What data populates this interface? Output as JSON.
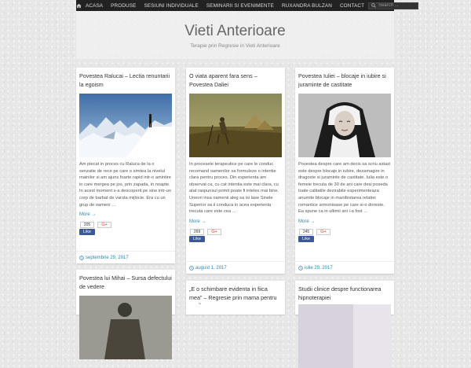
{
  "nav": {
    "items": [
      "ACASA",
      "PRODUSE",
      "SESIUNI INDIVIDUALE",
      "SEMINARII SI EVENIMENTE",
      "RUXANDRA BULZAN",
      "CONTACT"
    ],
    "search_placeholder": "Search ..."
  },
  "header": {
    "title": "Vieti Anterioare",
    "tagline": "Terapie prin Regresie in Vieti Anterioare"
  },
  "posts": [
    {
      "title": "Povestea Ralucai – Lectia renuntarii la egoism",
      "excerpt": "Am plecat in proces cu Raluca de la o senzatie de rece pe care o simtea la nivelul mainilor si am ajuns foarte rapid intr-o amintire in care mergea pe jos, prin zapada, in noapte. In acest moment s-a descoperit pe sine intr-un corp de barbat de varsta mijlocie. Era cu un grup de oameni …",
      "more": "More →",
      "fb_count": "205",
      "fb_like": "Like",
      "gplus": "G+",
      "date": "septembrie 29, 2017"
    },
    {
      "title": "O viata aparent fara sens – Povestea Daliei",
      "excerpt": "In procesele terapeutice pe care le conduc recomand oamenilor sa formuleze o intentie clara pentru proces. Din experienta am observat ca, cu cat intentia este mai clara, cu atat raspunsul primit poate fi inteles mai bine. Uneori insa oamenii aleg sa isi lase Sinele Superior sa ii conduca in acea experienta trecuta care este cea …",
      "more": "More →",
      "fb_count": "269",
      "fb_like": "Like",
      "gplus": "G+",
      "date": "august 1, 2017"
    },
    {
      "title": "Povestea Iuliei – blocaje in iubire si juraminte de castitate",
      "excerpt": "Povestea despre care am decis sa scriu astazi este despre blocaje in iubire, dezamagire in dragoste si juraminte de castitate. Iulia este o femeie trecuta de 30 de ani care desi poseda toate calitatile dezirabile experimenteaza anumite blocaje in manifestarea relatiei romantice armonioase pe care si-o doreste. Ea spune ca in ultimii ani i-a fost …",
      "more": "More →",
      "fb_count": "245",
      "fb_like": "Like",
      "gplus": "G+",
      "date": "iulie 29, 2017"
    },
    {
      "title": "Povestea lui Mihai – Sursa defectului de vedere"
    },
    {
      "title": "„E o schimbare evidenta in fiica mea” – Regresie prin mama pentru copil"
    },
    {
      "title": "Studii clinice despre functionarea hipnoterapiei"
    }
  ]
}
